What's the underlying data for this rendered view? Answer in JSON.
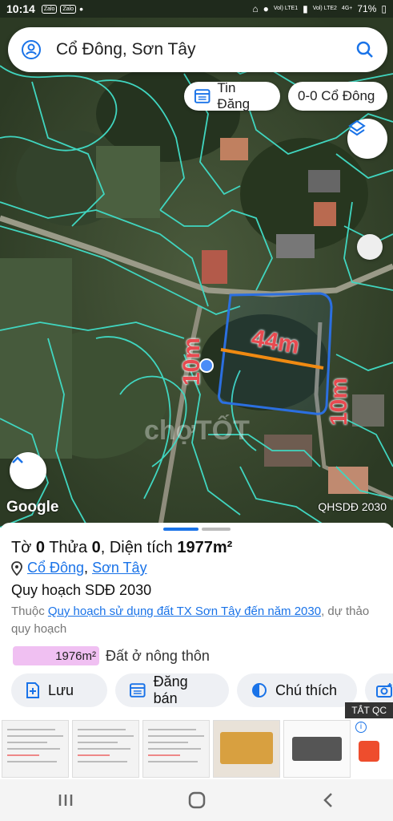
{
  "status_bar": {
    "time": "10:14",
    "apps": [
      "Zalo",
      "Zalo"
    ],
    "network_1": "Vol) LTE1",
    "network_2": "Vol) LTE2",
    "signal_tag": "4G+",
    "battery": "71%"
  },
  "search": {
    "query": "Cổ Đông, Sơn Tây",
    "icon_left": "location-person-icon",
    "icon_right": "search-icon"
  },
  "map": {
    "chips": {
      "listing_label": "Tin Đăng",
      "parcel_label": "0-0 Cổ Đông"
    },
    "dimensions": {
      "top": "44m",
      "left": "10m",
      "right": "10m"
    },
    "watermark": "chợTỐT",
    "logo": "Google",
    "layer_label": "QHSDĐ 2030"
  },
  "sheet": {
    "title": {
      "prefix_1": "Tờ ",
      "sheet_no": "0",
      "prefix_2": " Thửa ",
      "parcel_no": "0",
      "prefix_3": ", Diện tích ",
      "area": "1977m²"
    },
    "location": {
      "commune": "Cổ Đông",
      "separator": ", ",
      "town": "Sơn Tây"
    },
    "plan_title": "Quy hoạch SDĐ 2030",
    "description": {
      "prefix": "Thuộc ",
      "link": "Quy hoạch sử dụng đất TX Sơn Tây đến năm 2030",
      "suffix": ", dự thảo quy hoạch"
    },
    "legend": {
      "area": "1976m²",
      "label": "Đất ở nông thôn",
      "color": "#f0c0f2"
    },
    "actions": [
      {
        "label": "Lưu",
        "icon": "save-plus-icon"
      },
      {
        "label": "Đăng bán",
        "icon": "listing-icon"
      },
      {
        "label": "Chú thích",
        "icon": "legend-icon"
      }
    ]
  },
  "ad": {
    "close_label": "TẮT QC"
  },
  "colors": {
    "parcel_lines": "#40d6c0",
    "plot_outline": "#2b6fe0",
    "dimension_line": "#f08a12",
    "dimension_text": "#e84a50",
    "link": "#1a73e8"
  }
}
